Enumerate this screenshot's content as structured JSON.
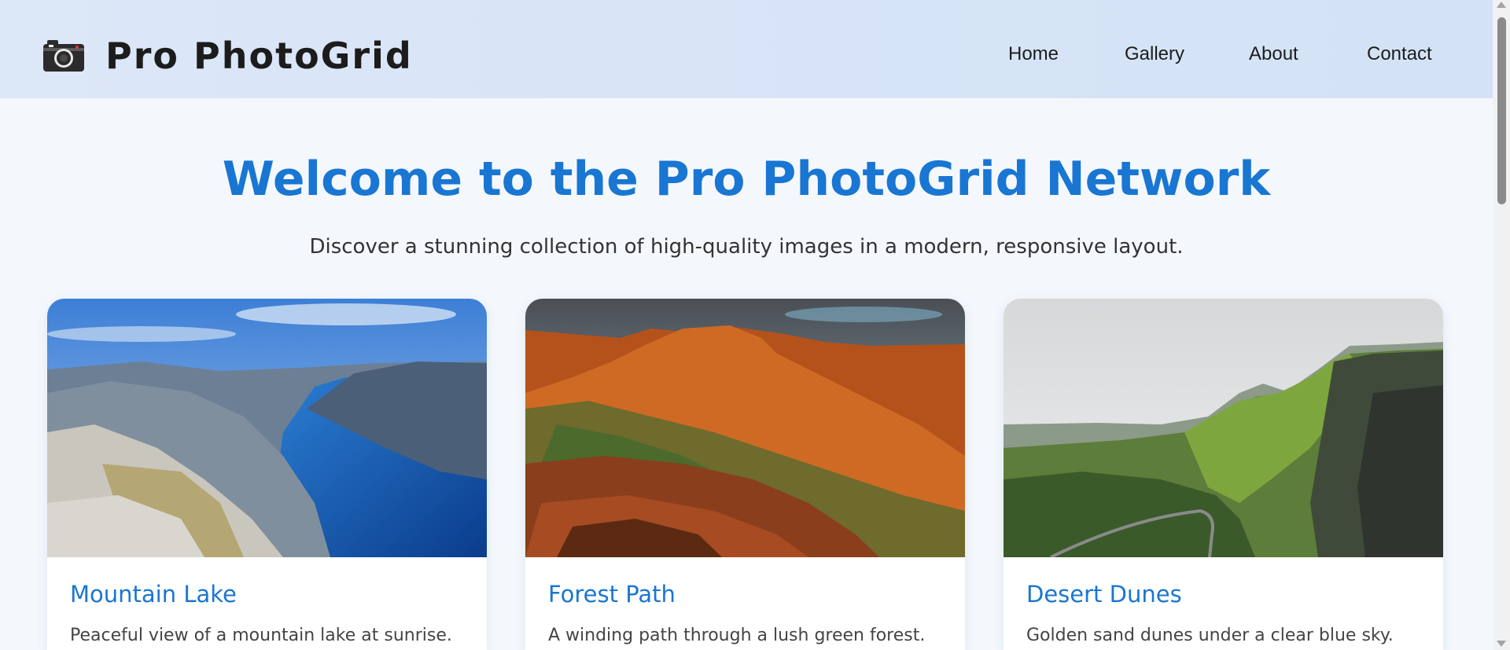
{
  "header": {
    "logo_icon": "camera-icon",
    "brand": "Pro PhotoGrid",
    "nav": [
      {
        "label": "Home"
      },
      {
        "label": "Gallery"
      },
      {
        "label": "About"
      },
      {
        "label": "Contact"
      }
    ]
  },
  "hero": {
    "title": "Welcome to the Pro PhotoGrid Network",
    "subtitle": "Discover a stunning collection of high-quality images in a modern, responsive layout."
  },
  "cards": [
    {
      "title": "Mountain Lake",
      "description": "Peaceful view of a mountain lake at sunrise.",
      "image": "fjord-landscape-photo"
    },
    {
      "title": "Forest Path",
      "description": "A winding path through a lush green forest.",
      "image": "red-rock-canyon-photo"
    },
    {
      "title": "Desert Dunes",
      "description": "Golden sand dunes under a clear blue sky.",
      "image": "green-highland-cliffs-photo"
    }
  ],
  "colors": {
    "accent": "#1976d2",
    "header_bg": "#dce7f8",
    "page_bg": "#f4f8fd"
  }
}
